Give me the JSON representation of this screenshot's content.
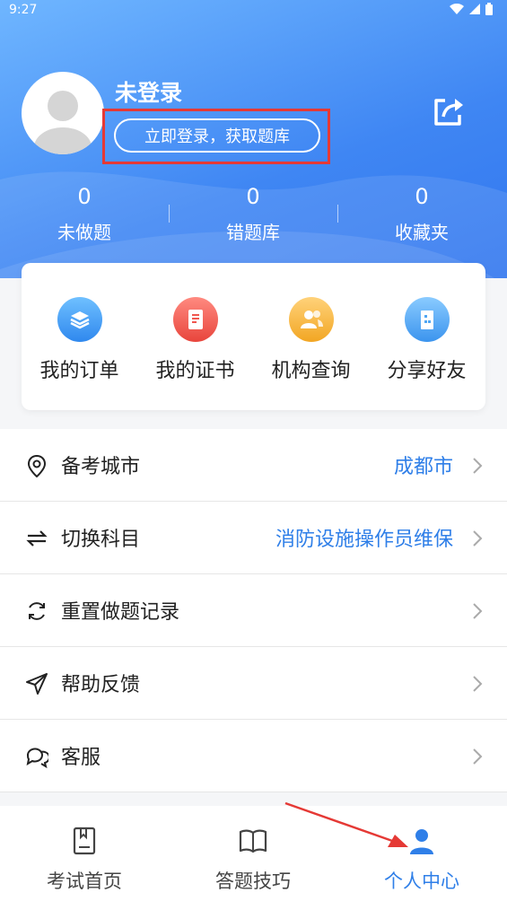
{
  "status_bar": {
    "time": "9:27"
  },
  "profile": {
    "username": "未登录",
    "login_button": "立即登录，获取题库"
  },
  "stats": [
    {
      "value": "0",
      "label": "未做题"
    },
    {
      "value": "0",
      "label": "错题库"
    },
    {
      "value": "0",
      "label": "收藏夹"
    }
  ],
  "quick_actions": [
    {
      "label": "我的订单",
      "icon": "layers-icon",
      "color": "#3a9cf0"
    },
    {
      "label": "我的证书",
      "icon": "certificate-icon",
      "color": "#f0574f"
    },
    {
      "label": "机构查询",
      "icon": "people-icon",
      "color": "#f6b73c"
    },
    {
      "label": "分享好友",
      "icon": "building-icon",
      "color": "#4fa6f3"
    }
  ],
  "menu": [
    {
      "label": "备考城市",
      "value": "成都市",
      "icon": "location-icon"
    },
    {
      "label": "切换科目",
      "value": "消防设施操作员维保",
      "icon": "switch-icon"
    },
    {
      "label": "重置做题记录",
      "value": "",
      "icon": "refresh-icon"
    },
    {
      "label": "帮助反馈",
      "value": "",
      "icon": "send-icon"
    },
    {
      "label": "客服",
      "value": "",
      "icon": "chat-icon"
    }
  ],
  "tabs": [
    {
      "label": "考试首页",
      "icon": "exam-book-icon"
    },
    {
      "label": "答题技巧",
      "icon": "open-book-icon"
    },
    {
      "label": "个人中心",
      "icon": "person-icon",
      "active": true
    }
  ],
  "colors": {
    "accent": "#2f7fe8",
    "header_gradient_start": "#6fb6ff",
    "header_gradient_end": "#2f73ee",
    "highlight_box": "#e53935"
  }
}
